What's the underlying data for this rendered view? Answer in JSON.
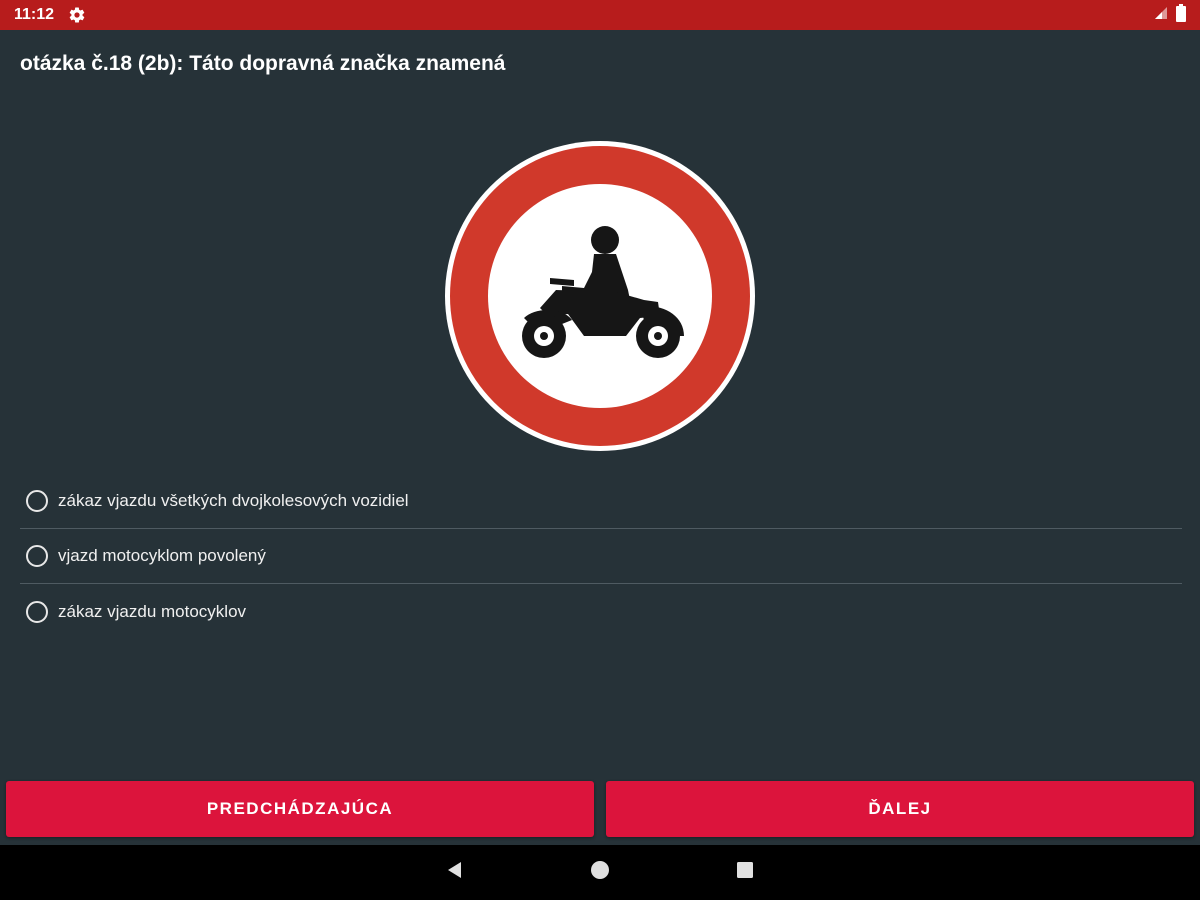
{
  "status_bar": {
    "time": "11:12",
    "icons": [
      "gear-icon",
      "signal-icon",
      "battery-icon"
    ],
    "color": "#b71c1c"
  },
  "question": {
    "title": "otázka č.18 (2b):  Táto dopravná značka znamená"
  },
  "sign": {
    "icon": "no-motorcycles-sign",
    "ring_color": "#d0392b",
    "symbol_color": "#161616"
  },
  "options": [
    {
      "label": "zákaz vjazdu všetkých dvojkolesových vozidiel",
      "selected": false
    },
    {
      "label": "vjazd motocyklom povolený",
      "selected": false
    },
    {
      "label": "zákaz vjazdu motocyklov",
      "selected": false
    }
  ],
  "buttons": {
    "previous_label": "PREDCHÁDZAJÚCA",
    "next_label": "ĎALEJ",
    "color": "#dc143c"
  },
  "nav_bar": {
    "icons": [
      "back-icon",
      "home-icon",
      "recents-icon"
    ]
  },
  "colors": {
    "background": "#263238"
  }
}
